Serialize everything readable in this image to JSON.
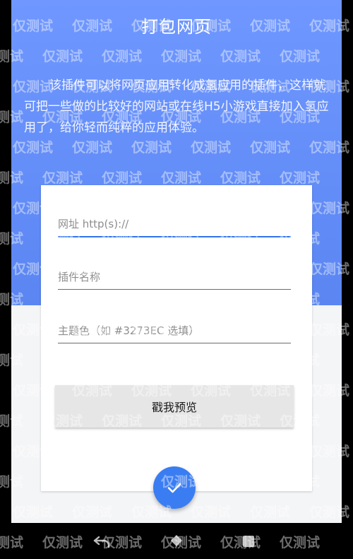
{
  "header": {
    "title": "打包网页",
    "description": "该插件可以将网页应用转化成氢应用的插件，这样就可把一些做的比较好的网站或在线H5小游戏直接加入氢应用了，给你轻而纯粹的应用体验。"
  },
  "form": {
    "url_placeholder": "网址 http(s)://",
    "name_placeholder": "插件名称",
    "color_placeholder": "主题色（如 #3273EC 选填）",
    "preview_label": "戳我预览"
  },
  "fab": {
    "icon": "check-icon"
  },
  "navbar": {
    "back_icon": "back-icon",
    "home_icon": "home-icon",
    "recents_icon": "recents-icon"
  },
  "watermark": {
    "text": "仅测试"
  },
  "colors": {
    "accent": "#3273EC",
    "hero": "#6F97FF",
    "fab": "#3A7DF3"
  }
}
